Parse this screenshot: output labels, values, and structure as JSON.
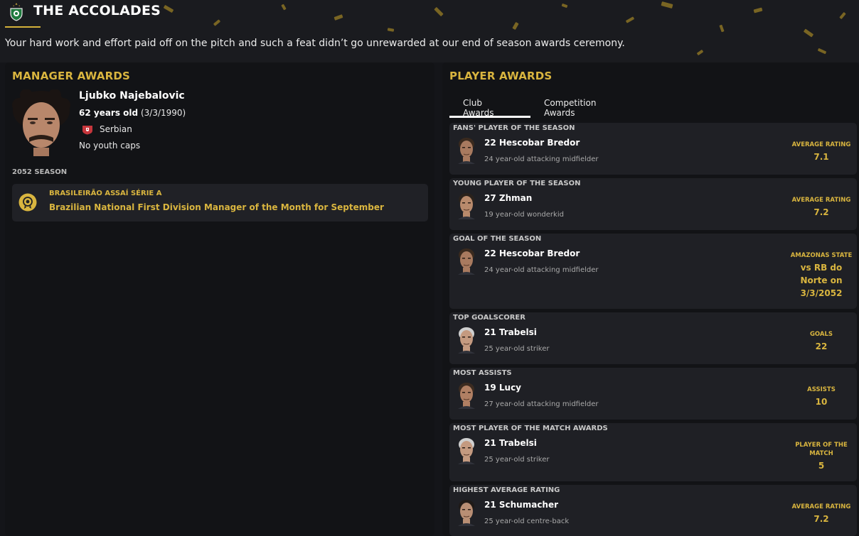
{
  "header": {
    "title": "THE ACCOLADES",
    "subtitle": "Your hard work and effort paid off on the pitch and such a feat didn’t go unrewarded at our end of season awards ceremony."
  },
  "colors": {
    "accent": "#d9b53f",
    "panel_bg": "#121316",
    "card_bg": "#1f2025"
  },
  "manager": {
    "section_title": "MANAGER AWARDS",
    "name": "Ljubko Najebalovic",
    "age_label": "62 years old",
    "dob": "(3/3/1990)",
    "nationality": "Serbian",
    "caps": "No youth caps",
    "season_label": "2052 SEASON",
    "awards": [
      {
        "competition": "BRASILEIRÃO ASSAÍ SÉRIE A",
        "award": "Brazilian National First Division Manager of the Month for September",
        "icon": "medal-icon"
      }
    ]
  },
  "players": {
    "section_title": "PLAYER AWARDS",
    "tabs": [
      "Club Awards",
      "Competition Awards"
    ],
    "active_tab": "Club Awards",
    "awards": [
      {
        "category": "FANS' PLAYER OF THE SEASON",
        "name": "22 Hescobar Bredor",
        "desc": "24 year-old attacking midfielder",
        "stat_label": "AVERAGE RATING",
        "stat_value": "7.1"
      },
      {
        "category": "YOUNG PLAYER OF THE SEASON",
        "name": "27 Zhman",
        "desc": "19 year-old wonderkid",
        "stat_label": "AVERAGE RATING",
        "stat_value": "7.2"
      },
      {
        "category": "GOAL OF THE SEASON",
        "name": "22 Hescobar Bredor",
        "desc": "24 year-old attacking midfielder",
        "stat_label": "AMAZONAS STATE",
        "stat_value": "vs RB do Norte on 3/3/2052"
      },
      {
        "category": "TOP GOALSCORER",
        "name": "21 Trabelsi",
        "desc": "25 year-old striker",
        "stat_label": "GOALS",
        "stat_value": "22"
      },
      {
        "category": "MOST ASSISTS",
        "name": "19 Lucy",
        "desc": "27 year-old attacking midfielder",
        "stat_label": "ASSISTS",
        "stat_value": "10"
      },
      {
        "category": "MOST PLAYER OF THE MATCH AWARDS",
        "name": "21 Trabelsi",
        "desc": "25 year-old striker",
        "stat_label": "PLAYER OF THE MATCH",
        "stat_value": "5"
      },
      {
        "category": "HIGHEST AVERAGE RATING",
        "name": "21 Schumacher",
        "desc": "25 year-old centre-back",
        "stat_label": "AVERAGE RATING",
        "stat_value": "7.2"
      }
    ]
  }
}
